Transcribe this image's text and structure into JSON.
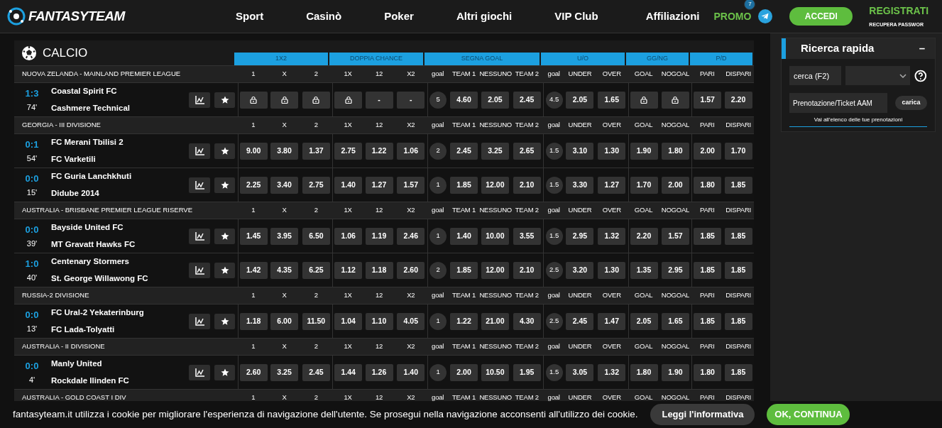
{
  "header": {
    "logo": "FANTASYTEAM",
    "nav": [
      "Sport",
      "Casinò",
      "Poker",
      "Altri giochi",
      "VIP Club"
    ],
    "affiliates": "Affiliazioni",
    "promo": {
      "label": "PROMO",
      "badge": "7"
    },
    "login": "ACCEDI",
    "register": "REGISTRATI",
    "recover": "RECUPERA PASSWOR"
  },
  "section": {
    "title": "CALCIO",
    "groups": [
      "1X2",
      "DOPPIA CHANCE",
      "SEGNA GOAL",
      "U/O",
      "GG/NG",
      "P/D"
    ],
    "leagues": [
      {
        "name": "NUOVA ZELANDA - MAINLAND PREMIER LEAGUE",
        "columns": [
          "1",
          "X",
          "2",
          "1X",
          "12",
          "X2",
          "goal",
          "TEAM 1",
          "NESSUNO",
          "TEAM 2",
          "goal",
          "UNDER",
          "OVER",
          "GOAL",
          "NOGOAL",
          "PARI",
          "DISPARI"
        ],
        "matches": [
          {
            "score": "1:3",
            "minute": "74'",
            "home": "Coastal Spirit FC",
            "away": "Cashmere Technical",
            "cells": [
              {
                "kind": "lock"
              },
              {
                "kind": "lock"
              },
              {
                "kind": "lock"
              },
              {
                "kind": "lock"
              },
              {
                "kind": "odd",
                "text": "-"
              },
              {
                "kind": "odd",
                "text": "-"
              },
              {
                "kind": "line",
                "text": "5"
              },
              {
                "kind": "odd",
                "text": "4.60"
              },
              {
                "kind": "odd",
                "text": "2.05"
              },
              {
                "kind": "odd",
                "text": "2.45"
              },
              {
                "kind": "line",
                "text": "4.5"
              },
              {
                "kind": "odd",
                "text": "2.05"
              },
              {
                "kind": "odd",
                "text": "1.65"
              },
              {
                "kind": "lock"
              },
              {
                "kind": "lock"
              },
              {
                "kind": "odd",
                "text": "1.57"
              },
              {
                "kind": "odd",
                "text": "2.20"
              }
            ]
          }
        ]
      },
      {
        "name": "GEORGIA - III DIVISIONE",
        "columns": [
          "1",
          "X",
          "2",
          "1X",
          "12",
          "X2",
          "goal",
          "TEAM 1",
          "NESSUNO",
          "TEAM 2",
          "goal",
          "UNDER",
          "OVER",
          "GOAL",
          "NOGOAL",
          "PARI",
          "DISPARI"
        ],
        "matches": [
          {
            "score": "0:1",
            "minute": "54'",
            "home": "FC Merani Tbilisi 2",
            "away": "FC Varketili",
            "cells": [
              {
                "kind": "odd",
                "text": "9.00"
              },
              {
                "kind": "odd",
                "text": "3.80"
              },
              {
                "kind": "odd",
                "text": "1.37"
              },
              {
                "kind": "odd",
                "text": "2.75"
              },
              {
                "kind": "odd",
                "text": "1.22"
              },
              {
                "kind": "odd",
                "text": "1.06"
              },
              {
                "kind": "line",
                "text": "2"
              },
              {
                "kind": "odd",
                "text": "2.45"
              },
              {
                "kind": "odd",
                "text": "3.25"
              },
              {
                "kind": "odd",
                "text": "2.65"
              },
              {
                "kind": "line",
                "text": "1.5"
              },
              {
                "kind": "odd",
                "text": "3.10"
              },
              {
                "kind": "odd",
                "text": "1.30"
              },
              {
                "kind": "odd",
                "text": "1.90"
              },
              {
                "kind": "odd",
                "text": "1.80"
              },
              {
                "kind": "odd",
                "text": "2.00"
              },
              {
                "kind": "odd",
                "text": "1.70"
              }
            ]
          },
          {
            "score": "0:0",
            "minute": "15'",
            "home": "FC Guria Lanchkhuti",
            "away": "Didube 2014",
            "cells": [
              {
                "kind": "odd",
                "text": "2.25"
              },
              {
                "kind": "odd",
                "text": "3.40"
              },
              {
                "kind": "odd",
                "text": "2.75"
              },
              {
                "kind": "odd",
                "text": "1.40"
              },
              {
                "kind": "odd",
                "text": "1.27"
              },
              {
                "kind": "odd",
                "text": "1.57"
              },
              {
                "kind": "line",
                "text": "1"
              },
              {
                "kind": "odd",
                "text": "1.85"
              },
              {
                "kind": "odd",
                "text": "12.00"
              },
              {
                "kind": "odd",
                "text": "2.10"
              },
              {
                "kind": "line",
                "text": "1.5"
              },
              {
                "kind": "odd",
                "text": "3.30"
              },
              {
                "kind": "odd",
                "text": "1.27"
              },
              {
                "kind": "odd",
                "text": "1.70"
              },
              {
                "kind": "odd",
                "text": "2.00"
              },
              {
                "kind": "odd",
                "text": "1.80"
              },
              {
                "kind": "odd",
                "text": "1.85"
              }
            ]
          }
        ]
      },
      {
        "name": "AUSTRALIA - BRISBANE PREMIER LEAGUE RISERVE",
        "columns": [
          "1",
          "X",
          "2",
          "1X",
          "12",
          "X2",
          "goal",
          "TEAM 1",
          "NESSUNO",
          "TEAM 2",
          "goal",
          "UNDER",
          "OVER",
          "GOAL",
          "NOGOAL",
          "PARI",
          "DISPARI"
        ],
        "matches": [
          {
            "score": "0:0",
            "minute": "39'",
            "home": "Bayside United FC",
            "away": "MT Gravatt Hawks FC",
            "cells": [
              {
                "kind": "odd",
                "text": "1.45"
              },
              {
                "kind": "odd",
                "text": "3.95"
              },
              {
                "kind": "odd",
                "text": "6.50"
              },
              {
                "kind": "odd",
                "text": "1.06"
              },
              {
                "kind": "odd",
                "text": "1.19"
              },
              {
                "kind": "odd",
                "text": "2.46"
              },
              {
                "kind": "line",
                "text": "1"
              },
              {
                "kind": "odd",
                "text": "1.40"
              },
              {
                "kind": "odd",
                "text": "10.00"
              },
              {
                "kind": "odd",
                "text": "3.55"
              },
              {
                "kind": "line",
                "text": "1.5"
              },
              {
                "kind": "odd",
                "text": "2.95"
              },
              {
                "kind": "odd",
                "text": "1.32"
              },
              {
                "kind": "odd",
                "text": "2.20"
              },
              {
                "kind": "odd",
                "text": "1.57"
              },
              {
                "kind": "odd",
                "text": "1.85"
              },
              {
                "kind": "odd",
                "text": "1.85"
              }
            ]
          },
          {
            "score": "1:0",
            "minute": "40'",
            "home": "Centenary Stormers",
            "away": "St. George Willawong FC",
            "cells": [
              {
                "kind": "odd",
                "text": "1.42"
              },
              {
                "kind": "odd",
                "text": "4.35"
              },
              {
                "kind": "odd",
                "text": "6.25"
              },
              {
                "kind": "odd",
                "text": "1.12"
              },
              {
                "kind": "odd",
                "text": "1.18"
              },
              {
                "kind": "odd",
                "text": "2.60"
              },
              {
                "kind": "line",
                "text": "2"
              },
              {
                "kind": "odd",
                "text": "1.85"
              },
              {
                "kind": "odd",
                "text": "12.00"
              },
              {
                "kind": "odd",
                "text": "2.10"
              },
              {
                "kind": "line",
                "text": "2.5"
              },
              {
                "kind": "odd",
                "text": "3.20"
              },
              {
                "kind": "odd",
                "text": "1.30"
              },
              {
                "kind": "odd",
                "text": "1.35"
              },
              {
                "kind": "odd",
                "text": "2.95"
              },
              {
                "kind": "odd",
                "text": "1.85"
              },
              {
                "kind": "odd",
                "text": "1.85"
              }
            ]
          }
        ]
      },
      {
        "name": "RUSSIA-2 DIVISIONE",
        "columns": [
          "1",
          "X",
          "2",
          "1X",
          "12",
          "X2",
          "goal",
          "TEAM 1",
          "NESSUNO",
          "TEAM 2",
          "goal",
          "UNDER",
          "OVER",
          "GOAL",
          "NOGOAL",
          "PARI",
          "DISPARI"
        ],
        "matches": [
          {
            "score": "0:0",
            "minute": "13'",
            "home": "FC Ural-2 Yekaterinburg",
            "away": "FC Lada-Tolyatti",
            "cells": [
              {
                "kind": "odd",
                "text": "1.18"
              },
              {
                "kind": "odd",
                "text": "6.00"
              },
              {
                "kind": "odd",
                "text": "11.50"
              },
              {
                "kind": "odd",
                "text": "1.04"
              },
              {
                "kind": "odd",
                "text": "1.10"
              },
              {
                "kind": "odd",
                "text": "4.05"
              },
              {
                "kind": "line",
                "text": "1"
              },
              {
                "kind": "odd",
                "text": "1.22"
              },
              {
                "kind": "odd",
                "text": "21.00"
              },
              {
                "kind": "odd",
                "text": "4.30"
              },
              {
                "kind": "line",
                "text": "2.5"
              },
              {
                "kind": "odd",
                "text": "2.45"
              },
              {
                "kind": "odd",
                "text": "1.47"
              },
              {
                "kind": "odd",
                "text": "2.05"
              },
              {
                "kind": "odd",
                "text": "1.65"
              },
              {
                "kind": "odd",
                "text": "1.85"
              },
              {
                "kind": "odd",
                "text": "1.85"
              }
            ]
          }
        ]
      },
      {
        "name": "AUSTRALIA - II DIVISIONE",
        "columns": [
          "1",
          "X",
          "2",
          "1X",
          "12",
          "X2",
          "goal",
          "TEAM 1",
          "NESSUNO",
          "TEAM 2",
          "goal",
          "UNDER",
          "OVER",
          "GOAL",
          "NOGOAL",
          "PARI",
          "DISPARI"
        ],
        "matches": [
          {
            "score": "0:0",
            "minute": "4'",
            "home": "Manly United",
            "away": "Rockdale Ilinden FC",
            "cells": [
              {
                "kind": "odd",
                "text": "2.60"
              },
              {
                "kind": "odd",
                "text": "3.25"
              },
              {
                "kind": "odd",
                "text": "2.45"
              },
              {
                "kind": "odd",
                "text": "1.44"
              },
              {
                "kind": "odd",
                "text": "1.26"
              },
              {
                "kind": "odd",
                "text": "1.40"
              },
              {
                "kind": "line",
                "text": "1"
              },
              {
                "kind": "odd",
                "text": "2.00"
              },
              {
                "kind": "odd",
                "text": "10.50"
              },
              {
                "kind": "odd",
                "text": "1.95"
              },
              {
                "kind": "line",
                "text": "1.5"
              },
              {
                "kind": "odd",
                "text": "3.05"
              },
              {
                "kind": "odd",
                "text": "1.32"
              },
              {
                "kind": "odd",
                "text": "1.80"
              },
              {
                "kind": "odd",
                "text": "1.90"
              },
              {
                "kind": "odd",
                "text": "1.80"
              },
              {
                "kind": "odd",
                "text": "1.85"
              }
            ]
          }
        ]
      },
      {
        "name": "AUSTRALIA - GOLD COAST I DIV",
        "columns": [
          "1",
          "X",
          "2",
          "1X",
          "12",
          "X2",
          "goal",
          "TEAM 1",
          "NESSUNO",
          "TEAM 2",
          "goal",
          "UNDER",
          "OVER",
          "GOAL",
          "NOGOAL",
          "PARI",
          "DISPARI"
        ]
      }
    ]
  },
  "quick_search": {
    "title": "Ricerca rapida",
    "collapse": "–",
    "search_placeholder": "cerca (F2)",
    "ticket_placeholder": "Prenotazione/Ticket AAM",
    "load": "carica",
    "link": "Vai all'elenco delle tue prenotazioni"
  },
  "cookie_bar": {
    "text": "fantasyteam.it utilizza i cookie per migliorare l'esperienza di navigazione dell'utente. Se prosegui nella navigazione acconsenti all'utilizzo dei cookie.",
    "info": "Leggi l'informativa",
    "ok": "OK, CONTINUA"
  }
}
